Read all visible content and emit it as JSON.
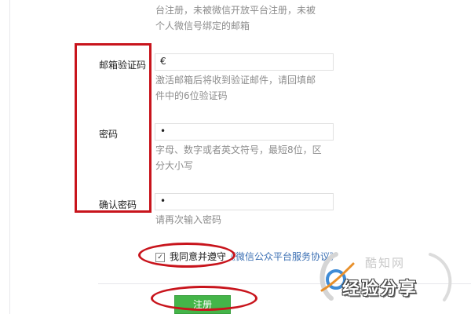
{
  "intro_hint_lines": [
    "台注册，未被微信开放平台注册，未被",
    "个人微信号绑定的邮箱"
  ],
  "email_code": {
    "label": "邮箱验证码",
    "value": "€",
    "hint_lines": [
      "激活邮箱后将收到验证邮件，请回填邮",
      "件中的6位验证码"
    ]
  },
  "password": {
    "label": "密码",
    "value": "•",
    "hint_lines": [
      "字母、数字或者英文符号，最短8位，区",
      "分大小写"
    ]
  },
  "confirm_password": {
    "label": "确认密码",
    "value": "•",
    "hint": "请再次输入密码"
  },
  "agreement": {
    "checkbox_mark": "✓",
    "text": "我同意并遵守",
    "link": "《微信公众平台服务协议》"
  },
  "register_button": "注册",
  "watermark": {
    "brand": "酷知网",
    "text": "经验分享"
  },
  "colors": {
    "annotation": "#c8141c",
    "button": "#44b549",
    "link": "#3b6fb3"
  }
}
